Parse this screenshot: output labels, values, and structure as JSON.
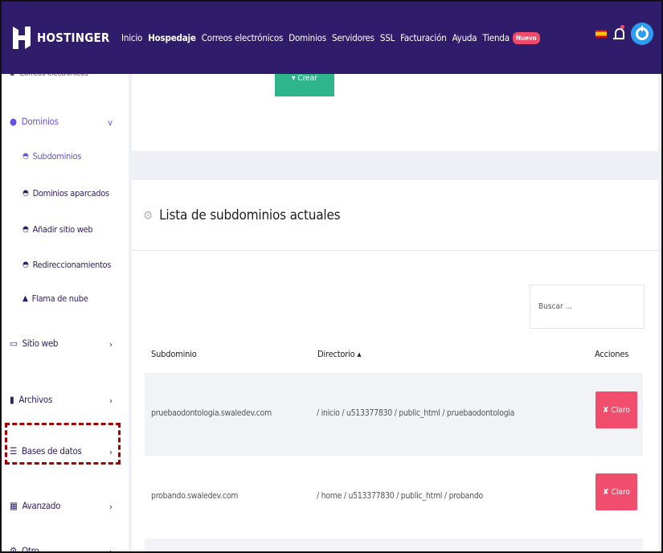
{
  "brand": {
    "name": "HOSTINGER"
  },
  "nav": {
    "items": [
      "Inicio",
      "Hospedaje",
      "Correos electrónicos",
      "Dominios",
      "Servidores",
      "SSL",
      "Facturación",
      "Ayuda",
      "Tienda"
    ],
    "active": "Hospedaje",
    "badge": "Nuevo"
  },
  "sidebar": {
    "partial_top": "Correos electrónicos",
    "dominios": {
      "label": "Dominios",
      "chevron": "v"
    },
    "subitems": [
      "Subdominios",
      "Dominios aparcados",
      "Añadir sitio web",
      "Redireccionamientos"
    ],
    "cloud": "Flama de nube",
    "items": [
      "Sitio web",
      "Archivos",
      "Bases de datos",
      "Avanzado",
      "Otro"
    ],
    "chevron": "›"
  },
  "top_card": {
    "button_label": "▾ Crear"
  },
  "list": {
    "title": "Lista de subdominios actuales",
    "search_placeholder": "Buscar ...",
    "columns": {
      "subdomain": "Subdominio",
      "directory": "Directorio ▴",
      "actions": "Acciones"
    },
    "rows": [
      {
        "subdomain": "pruebaodontologia.swaledev.com",
        "directory": "/ inicio / u513377830 / public_html / pruebaodontologia",
        "action": "✘ Claro"
      },
      {
        "subdomain": "probando.swaledev.com",
        "directory": "/ home / u513377830 / public_html / probando",
        "action": "✘ Claro"
      }
    ]
  },
  "colors": {
    "navbar": "#2f1c6a",
    "accent_purple": "#6b4de6",
    "green": "#2fb58b",
    "danger": "#f04e6c",
    "highlight_dashes": "#a00000"
  }
}
